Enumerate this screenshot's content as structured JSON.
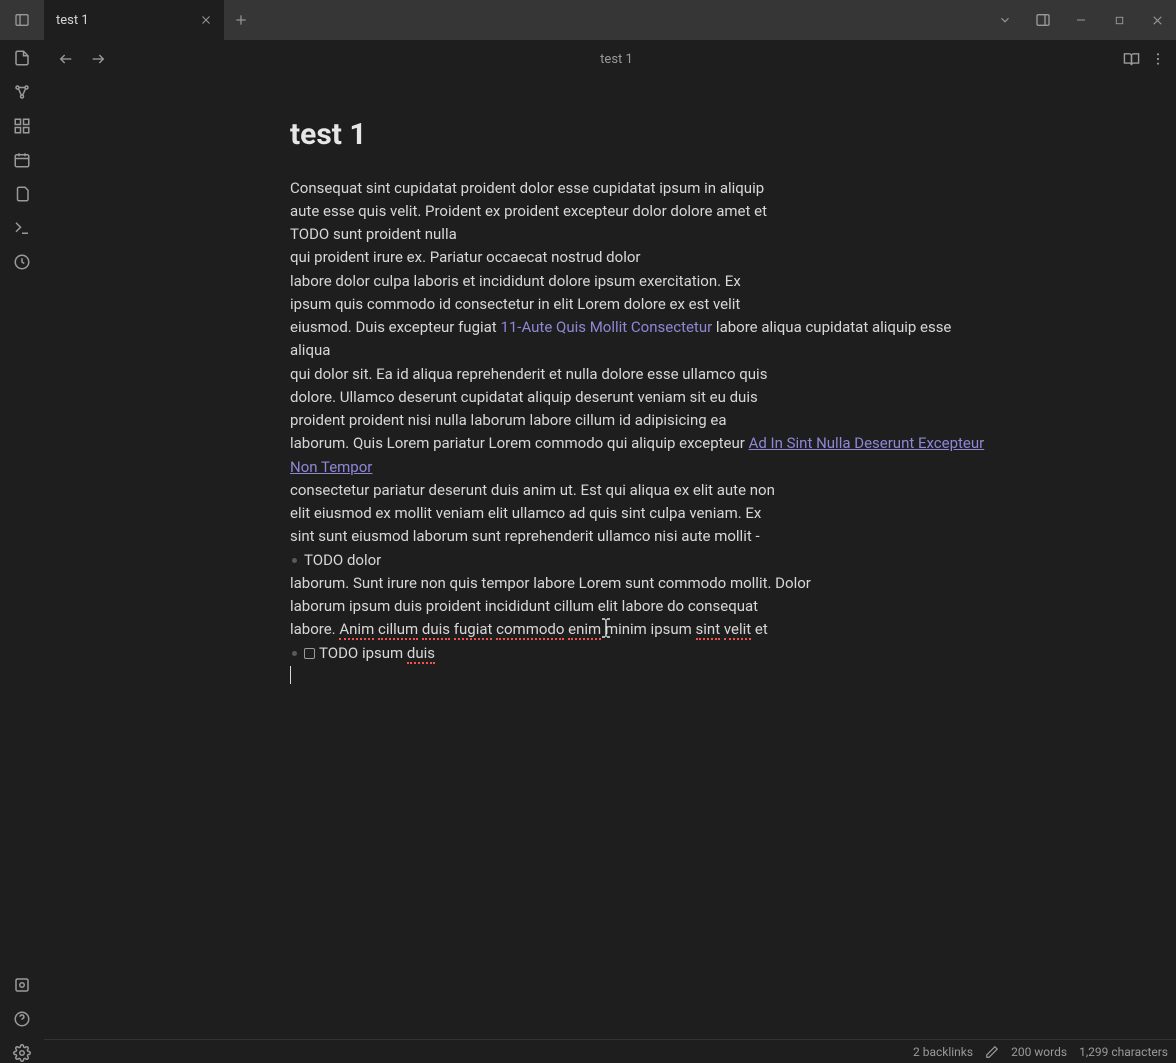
{
  "tabs": [
    {
      "title": "test 1"
    }
  ],
  "view": {
    "title": "test 1"
  },
  "note": {
    "heading": "test 1",
    "lines": [
      {
        "t": "text",
        "v": "Consequat sint cupidatat proident dolor esse cupidatat ipsum in aliquip"
      },
      {
        "t": "text",
        "v": "aute esse quis velit. Proident ex proident excepteur dolor dolore amet et"
      },
      {
        "t": "text",
        "v": "TODO sunt proident nulla"
      },
      {
        "t": "text",
        "v": "qui proident irure ex. Pariatur occaecat nostrud dolor"
      },
      {
        "t": "text",
        "v": "labore dolor culpa laboris et incididunt dolore ipsum exercitation. Ex"
      },
      {
        "t": "text",
        "v": "ipsum quis commodo id consectetur in elit Lorem dolore ex est velit"
      },
      {
        "t": "mixed",
        "parts": [
          {
            "k": "text",
            "v": "eiusmod. Duis excepteur fugiat "
          },
          {
            "k": "link",
            "v": "11-Aute Quis Mollit Consectetur",
            "ul": false
          },
          {
            "k": "text",
            "v": " labore aliqua cupidatat aliquip esse aliqua"
          }
        ]
      },
      {
        "t": "text",
        "v": "qui dolor sit. Ea id aliqua reprehenderit et nulla dolore esse ullamco quis"
      },
      {
        "t": "text",
        "v": "dolore. Ullamco deserunt cupidatat aliquip deserunt veniam sit eu duis"
      },
      {
        "t": "text",
        "v": "proident proident nisi nulla laborum labore cillum id adipisicing ea"
      },
      {
        "t": "mixed",
        "parts": [
          {
            "k": "text",
            "v": "laborum. Quis Lorem pariatur Lorem commodo qui aliquip excepteur "
          },
          {
            "k": "link",
            "v": "Ad In Sint Nulla Deserunt Excepteur Non Tempor",
            "ul": true
          }
        ]
      },
      {
        "t": "text",
        "v": "consectetur pariatur deserunt duis anim ut. Est qui aliqua ex elit aute non"
      },
      {
        "t": "text",
        "v": "elit eiusmod ex mollit veniam elit ullamco ad quis sint culpa veniam. Ex"
      },
      {
        "t": "text",
        "v": "sint sunt eiusmod laborum sunt reprehenderit ullamco nisi aute mollit -"
      },
      {
        "t": "bullet",
        "v": "TODO dolor"
      },
      {
        "t": "text",
        "v": "laborum. Sunt irure non quis tempor labore Lorem sunt commodo mollit. Dolor"
      },
      {
        "t": "text",
        "v": "laborum ipsum duis proident incididunt cillum elit labore do consequat"
      },
      {
        "t": "spellmix",
        "parts": [
          {
            "k": "text",
            "v": "labore. "
          },
          {
            "k": "spell",
            "v": "Anim"
          },
          {
            "k": "text",
            "v": " "
          },
          {
            "k": "spell",
            "v": "cillum"
          },
          {
            "k": "text",
            "v": " "
          },
          {
            "k": "spell",
            "v": "duis"
          },
          {
            "k": "text",
            "v": " "
          },
          {
            "k": "spell",
            "v": "fugiat"
          },
          {
            "k": "text",
            "v": " "
          },
          {
            "k": "spell",
            "v": "commodo"
          },
          {
            "k": "text",
            "v": " "
          },
          {
            "k": "spell",
            "v": "enim"
          },
          {
            "k": "text",
            "v": " minim ipsum "
          },
          {
            "k": "spell",
            "v": "sint"
          },
          {
            "k": "text",
            "v": " "
          },
          {
            "k": "spell",
            "v": "velit"
          },
          {
            "k": "text",
            "v": " et"
          }
        ]
      },
      {
        "t": "todo",
        "parts": [
          {
            "k": "text",
            "v": "TODO ipsum "
          },
          {
            "k": "spell",
            "v": "duis"
          }
        ]
      }
    ]
  },
  "status": {
    "backlinks": "2 backlinks",
    "words": "200 words",
    "chars": "1,299 characters"
  },
  "icons": {
    "side_toggle": "panel-left-icon",
    "tab_close": "close-icon",
    "tab_add": "plus-icon",
    "chevron_down": "chevron-down-icon",
    "panel_right": "panel-right-icon",
    "minimize": "minimize-icon",
    "maximize": "maximize-icon",
    "close": "close-icon",
    "nav_back": "arrow-left-icon",
    "nav_fwd": "arrow-right-icon",
    "reading": "book-open-icon",
    "more": "more-vertical-icon",
    "ribbon": [
      "file-plus-icon",
      "graph-icon",
      "grid-icon",
      "calendar-icon",
      "files-icon",
      "terminal-icon",
      "clock-icon"
    ],
    "ribbon_bottom": [
      "vault-icon",
      "help-icon",
      "settings-icon"
    ],
    "pen": "pen-icon"
  }
}
